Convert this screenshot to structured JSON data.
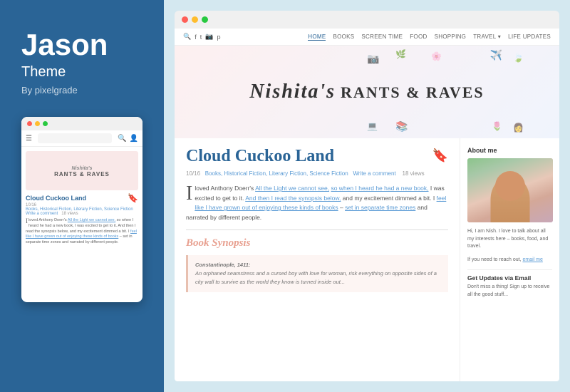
{
  "left_panel": {
    "theme_name": "Jason",
    "theme_word": "Theme",
    "author": "By pixelgrade"
  },
  "browser": {
    "dots": [
      "red",
      "yellow",
      "green"
    ]
  },
  "site_nav": {
    "icons": [
      "search",
      "facebook",
      "twitter",
      "instagram",
      "pinterest"
    ],
    "links": [
      "HOME",
      "BOOKS",
      "SCREEN TIME",
      "FOOD",
      "SHOPPING",
      "TRAVEL",
      "LIFE UPDATES"
    ],
    "active": "HOME"
  },
  "blog": {
    "header_name": "Nishita's",
    "header_subtitle": "RANTS & RAVES"
  },
  "post": {
    "title": "Cloud Cuckoo Land",
    "bookmark_icon": "🔖",
    "date": "10/16",
    "categories": "Books, Historical Fiction, Literary Fiction, Science Fiction",
    "comment": "Write a comment",
    "views": "18 views",
    "excerpt": "loved Anthony Doerr's All the Light we cannot see, so when I heard he had a new book, I was excited to get to it. And then I read the synopsis below, and my excitement dimmed a bit. I feel like I have grown out of enjoying these kinds of books – set in separate time zones and narrated by different people.",
    "section_title": "Book Synopsis",
    "quote_title": "Constantinople, 1411:",
    "quote_text": "An orphaned seamstress and a cursed boy with love for woman, risk everything on opposite sides of a city wall to survive as the world they know is turned inside out..."
  },
  "sidebar": {
    "about_title": "About me",
    "about_text": "Hi, I am Nish. I love to talk about all my interests here – books, food, and travel.",
    "about_link": "email me",
    "contact_text": "If you need to reach out,",
    "updates_title": "Get Updates via Email",
    "updates_text": "Don't miss a thing! Sign up to receive all the good stuff..."
  },
  "mobile": {
    "blog_name": "Nishita's RANTS & RAVES",
    "post_title": "Cloud Cuckoo Land",
    "post_meta": "10/16\nBooks, Historical Fiction, Literary Fiction, Science Fiction\nWrite a comment    18 views",
    "excerpt": "I loved Anthony Doerr's All the Light we cannot see, so when I heard he had a new book, I was excited to get to it. And then I read the synopsis below, and my excitement dimmed a bit. I feel like I have grown out of enjoying these kinds of books – set in separate time zones and narrated by different people."
  }
}
